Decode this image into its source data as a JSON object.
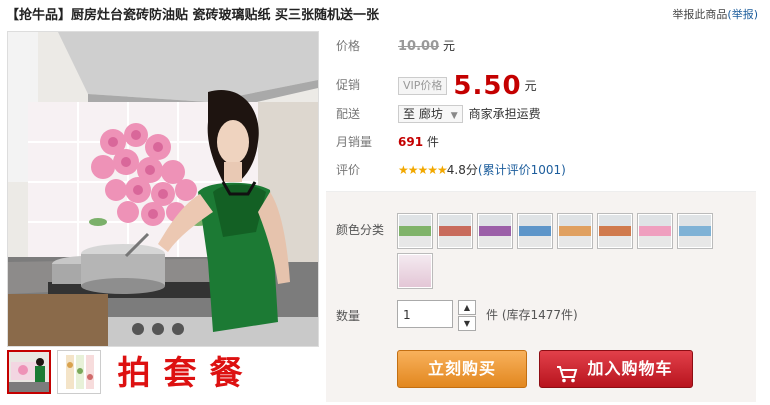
{
  "product": {
    "title": "【抢牛品】厨房灶台瓷砖防油贴 瓷砖玻璃贴纸 买三张随机送一张",
    "report_text": "举报此商品",
    "report_link": "(举报)"
  },
  "info": {
    "price_label": "价格",
    "price_old": "10.00",
    "price_unit": "元",
    "promo_label": "促销",
    "vip_badge": "VIP价格",
    "price_new": "5.50",
    "promo_unit": "元",
    "ship_label": "配送",
    "ship_dest_prefix": "至",
    "ship_dest": "廊坊",
    "ship_note": "商家承担运费",
    "sales_label": "月销量",
    "sales_count": "691",
    "sales_unit": "件",
    "rating_label": "评价",
    "rating_stars": "★★★★★",
    "rating_value": "4.8分",
    "rating_reviews": "(累计评价1001)"
  },
  "purchase": {
    "color_label": "颜色分类",
    "qty_label": "数量",
    "qty_value": "1",
    "stock_text": "件 (库存1477件)",
    "buy_now": "立刻购买",
    "add_to_cart": "加入购物车"
  },
  "thumbs": {
    "char1": "拍",
    "char2": "套",
    "char3": "餐"
  },
  "colors": {
    "accent": "#c40000",
    "link": "#1c5d9c"
  }
}
